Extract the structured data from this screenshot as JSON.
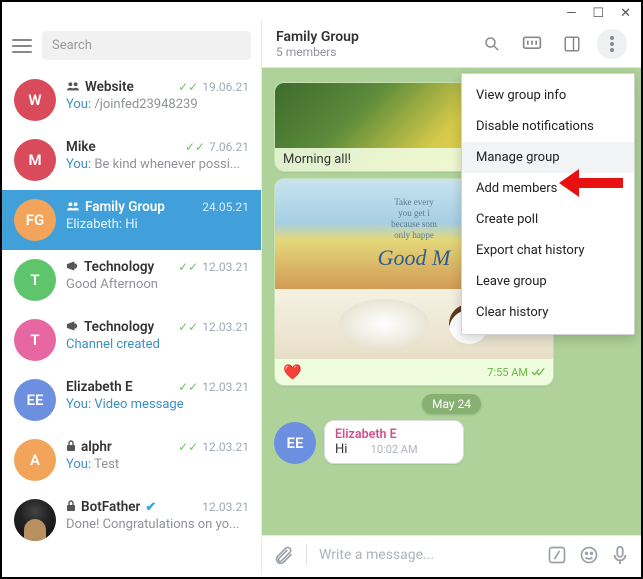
{
  "window": {
    "min": "—",
    "max": "☐",
    "close": "✕"
  },
  "sidebar": {
    "search_placeholder": "Search",
    "chats": [
      {
        "icon": "group",
        "name": "Website",
        "date": "19.06.21",
        "checks": true,
        "subtitle_prefix": "You:",
        "subtitle": " /joinfed23948239",
        "avatar_bg": "#d94b5a",
        "avatar_text": "W"
      },
      {
        "icon": "",
        "name": "Mike",
        "date": "7.06.21",
        "checks": true,
        "subtitle_prefix": "You:",
        "subtitle": " Be kind whenever possi...",
        "avatar_bg": "#d94b5a",
        "avatar_text": "M"
      },
      {
        "icon": "group",
        "name": "Family Group",
        "date": "24.05.21",
        "checks": false,
        "subtitle_prefix": "Elizabeth:",
        "subtitle": " Hi",
        "avatar_bg": "#f2a55a",
        "avatar_text": "FG",
        "active": true
      },
      {
        "icon": "channel",
        "name": "Technology",
        "date": "12.03.21",
        "checks": true,
        "subtitle_prefix": "",
        "subtitle": "Good Afternoon",
        "avatar_bg": "#5fc56d",
        "avatar_text": "T"
      },
      {
        "icon": "channel",
        "name": "Technology",
        "date": "12.03.21",
        "checks": true,
        "subtitle_prefix": "",
        "subtitle": "Channel created",
        "avatar_bg": "#e667a2",
        "avatar_text": "T",
        "subtitle_link": true
      },
      {
        "icon": "",
        "name": "Elizabeth E",
        "date": "12.03.21",
        "checks": true,
        "subtitle_prefix": "You:",
        "subtitle": " Video message",
        "avatar_bg": "#6d8fe0",
        "avatar_text": "EE",
        "subtitle_link": true
      },
      {
        "icon": "lock",
        "name": "alphr",
        "date": "12.03.21",
        "checks": true,
        "subtitle_prefix": "You:",
        "subtitle": " Test",
        "avatar_bg": "#f2a55a",
        "avatar_text": "A"
      },
      {
        "icon": "lock",
        "name": "BotFather",
        "verified": true,
        "date": "12.03.21",
        "checks": false,
        "subtitle_prefix": "",
        "subtitle": "Done! Congratulations on yo...",
        "avatar_img": true
      }
    ]
  },
  "header": {
    "title": "Family Group",
    "subtitle": "5 members"
  },
  "messages": {
    "card1_caption": "Morning all!",
    "card2_quote_l1": "Take every",
    "card2_quote_l2": "you get i",
    "card2_quote_l3": "because som",
    "card2_quote_l4": "only happe",
    "card2_gm": "Good M",
    "heart": "❤️",
    "card2_time": "7:55 AM",
    "date_chip": "May 24",
    "incoming": {
      "avatar_text": "EE",
      "sender": "Elizabeth E",
      "text": "Hi",
      "time": "10:02 AM"
    }
  },
  "composer": {
    "placeholder": "Write a message..."
  },
  "menu": {
    "items": [
      "View group info",
      "Disable notifications",
      "Manage group",
      "Add members",
      "Create poll",
      "Export chat history",
      "Leave group",
      "Clear history"
    ],
    "hover_index": 2
  }
}
